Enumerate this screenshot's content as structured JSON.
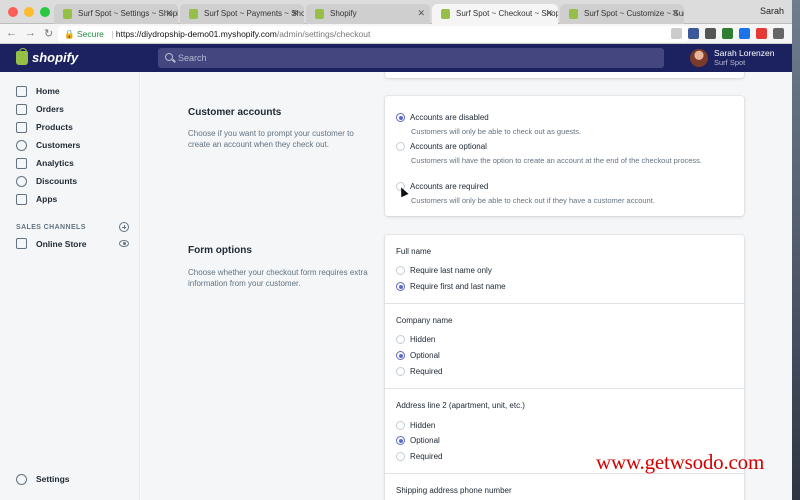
{
  "browser": {
    "tabs": [
      {
        "label": "Surf Spot ~ Settings ~ Shopify",
        "active": false
      },
      {
        "label": "Surf Spot ~ Payments ~ Shopify",
        "active": false
      },
      {
        "label": "Shopify",
        "active": false
      },
      {
        "label": "Surf Spot ~ Checkout ~ Shopify",
        "active": true
      },
      {
        "label": "Surf Spot ~ Customize ~ Surf",
        "active": false
      }
    ],
    "profile": "Sarah",
    "secure_label": "Secure",
    "url_host": "https://diydropship-demo01.myshopify.com",
    "url_path": "/admin/settings/checkout"
  },
  "topbar": {
    "brand": "shopify",
    "search_placeholder": "Search",
    "user_name": "Sarah Lorenzen",
    "store_name": "Surf Spot"
  },
  "sidebar": {
    "items": [
      {
        "label": "Home",
        "icon": "home-icon"
      },
      {
        "label": "Orders",
        "icon": "orders-icon"
      },
      {
        "label": "Products",
        "icon": "products-icon"
      },
      {
        "label": "Customers",
        "icon": "customers-icon"
      },
      {
        "label": "Analytics",
        "icon": "analytics-icon"
      },
      {
        "label": "Discounts",
        "icon": "discounts-icon"
      },
      {
        "label": "Apps",
        "icon": "apps-icon"
      }
    ],
    "sales_channels_label": "SALES CHANNELS",
    "online_store_label": "Online Store",
    "settings_label": "Settings"
  },
  "customer_accounts": {
    "title": "Customer accounts",
    "description": "Choose if you want to prompt your customer to create an account when they check out.",
    "options": [
      {
        "label": "Accounts are disabled",
        "help": "Customers will only be able to check out as guests.",
        "checked": true
      },
      {
        "label": "Accounts are optional",
        "help": "Customers will have the option to create an account at the end of the checkout process.",
        "checked": false
      },
      {
        "label": "Accounts are required",
        "help": "Customers will only be able to check out if they have a customer account.",
        "checked": false
      }
    ]
  },
  "form_options": {
    "title": "Form options",
    "description": "Choose whether your checkout form requires extra information from your customer.",
    "full_name": {
      "label": "Full name",
      "options": [
        {
          "label": "Require last name only",
          "checked": false
        },
        {
          "label": "Require first and last name",
          "checked": true
        }
      ]
    },
    "company_name": {
      "label": "Company name",
      "options": [
        {
          "label": "Hidden",
          "checked": false
        },
        {
          "label": "Optional",
          "checked": true
        },
        {
          "label": "Required",
          "checked": false
        }
      ]
    },
    "address_line2": {
      "label": "Address line 2 (apartment, unit, etc.)",
      "options": [
        {
          "label": "Hidden",
          "checked": false
        },
        {
          "label": "Optional",
          "checked": true
        },
        {
          "label": "Required",
          "checked": false
        }
      ]
    },
    "shipping_phone_label": "Shipping address phone number"
  },
  "watermark": "www.getwsodo.com",
  "colors": {
    "topbar": "#1c2260",
    "accent": "#5c6ac4",
    "sidebar_bg": "#f4f6f8",
    "watermark": "#d40000"
  }
}
